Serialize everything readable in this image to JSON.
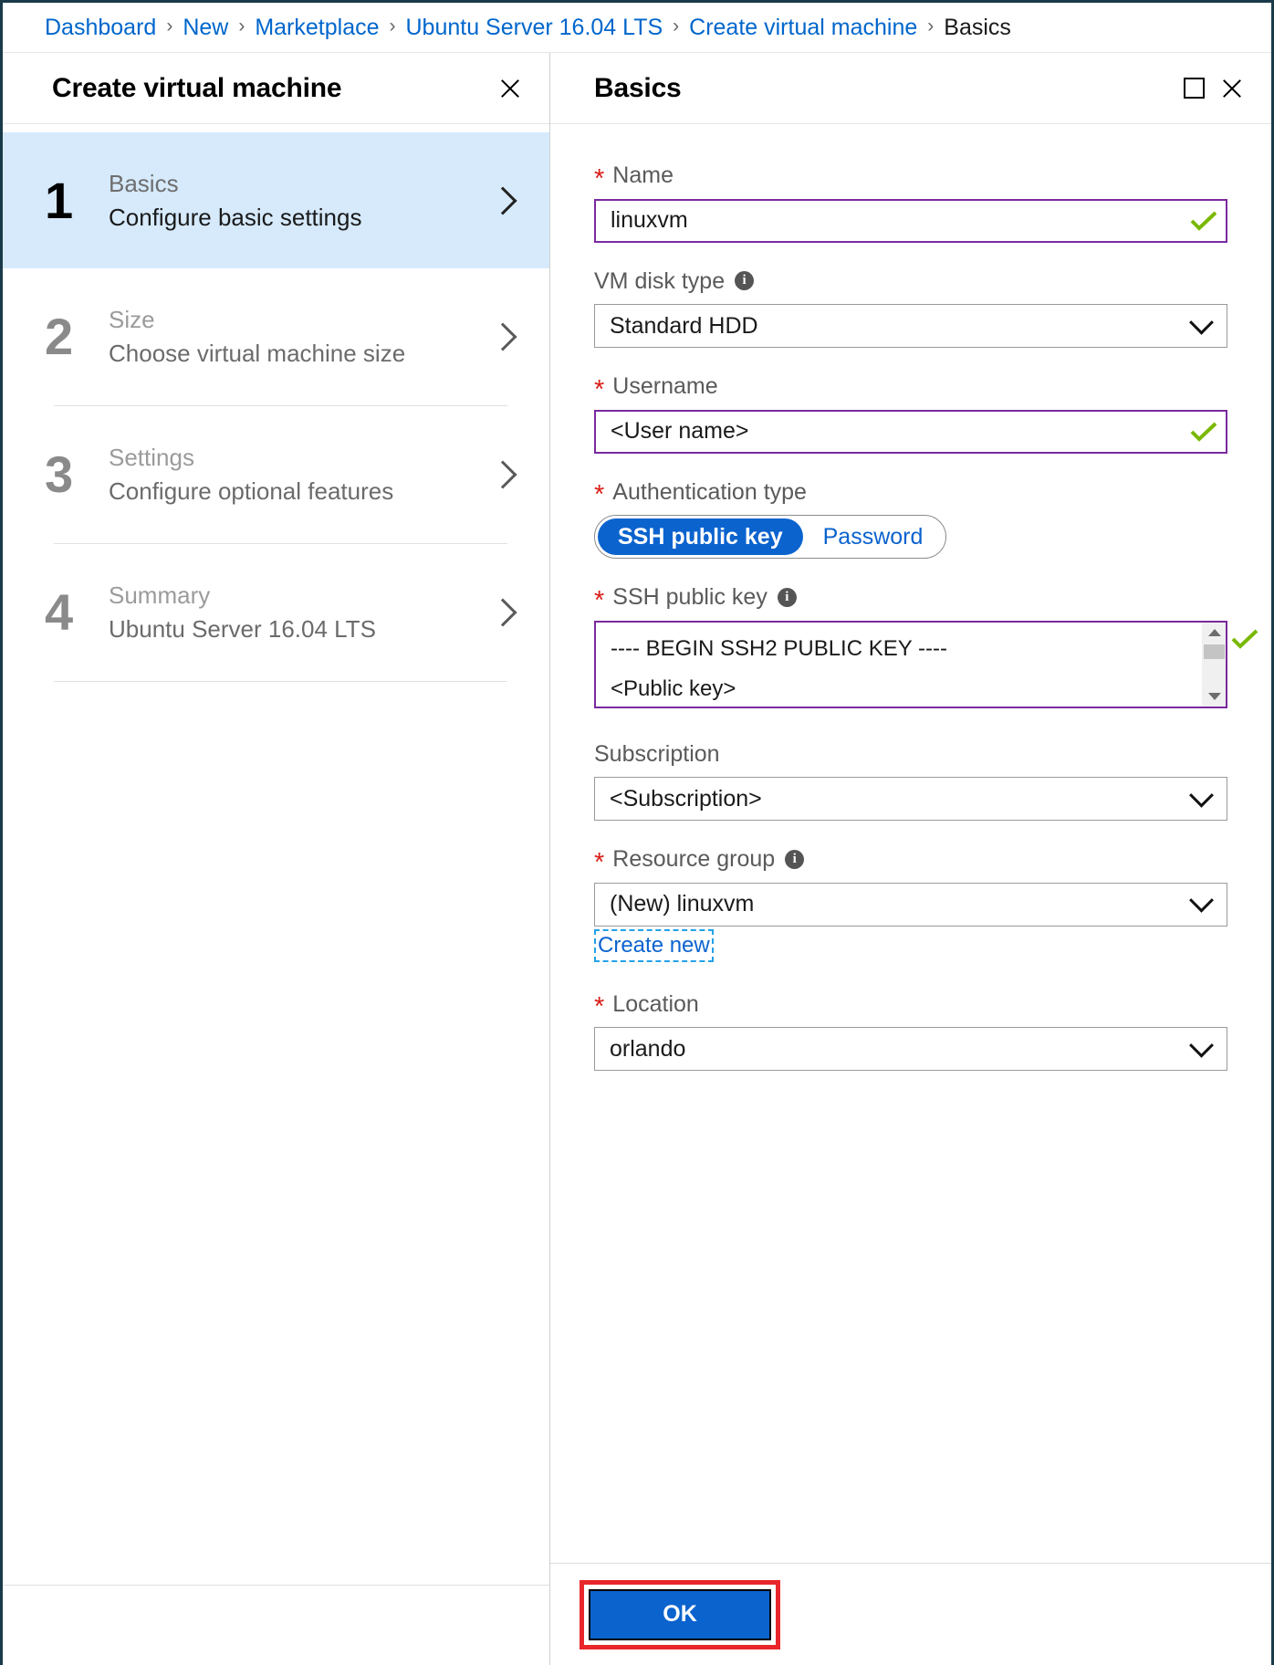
{
  "breadcrumb": {
    "items": [
      {
        "label": "Dashboard",
        "current": false
      },
      {
        "label": "New",
        "current": false
      },
      {
        "label": "Marketplace",
        "current": false
      },
      {
        "label": "Ubuntu Server 16.04 LTS",
        "current": false
      },
      {
        "label": "Create virtual machine",
        "current": false
      },
      {
        "label": "Basics",
        "current": true
      }
    ],
    "separator": "›"
  },
  "left_blade": {
    "title": "Create virtual machine",
    "close_icon": "close-icon",
    "steps": [
      {
        "num": "1",
        "name": "Basics",
        "desc": "Configure basic settings",
        "active": true
      },
      {
        "num": "2",
        "name": "Size",
        "desc": "Choose virtual machine size",
        "active": false
      },
      {
        "num": "3",
        "name": "Settings",
        "desc": "Configure optional features",
        "active": false
      },
      {
        "num": "4",
        "name": "Summary",
        "desc": "Ubuntu Server 16.04 LTS",
        "active": false
      }
    ]
  },
  "right_blade": {
    "title": "Basics",
    "maximize_icon": "maximize-icon",
    "close_icon": "close-icon",
    "fields": {
      "name": {
        "label": "Name",
        "value": "linuxvm",
        "required": true,
        "valid": true
      },
      "vm_disk_type": {
        "label": "VM disk type",
        "value": "Standard HDD",
        "required": false,
        "info": true
      },
      "username": {
        "label": "Username",
        "value": "<User name>",
        "required": true,
        "valid": true
      },
      "auth_type": {
        "label": "Authentication type",
        "required": true,
        "options": [
          "SSH public key",
          "Password"
        ],
        "selected": "SSH public key"
      },
      "ssh_public_key": {
        "label": "SSH public key",
        "required": true,
        "info": true,
        "line1": "---- BEGIN SSH2 PUBLIC KEY ----",
        "line2": "<Public key>",
        "valid": true
      },
      "subscription": {
        "label": "Subscription",
        "value": "<Subscription>",
        "required": false
      },
      "resource_group": {
        "label": "Resource group",
        "value": "(New) linuxvm",
        "required": true,
        "info": true,
        "create_new_label": "Create new"
      },
      "location": {
        "label": "Location",
        "value": "orlando",
        "required": true
      }
    },
    "footer": {
      "ok_label": "OK"
    }
  },
  "colors": {
    "accent_blue": "#0b63ce",
    "link_blue": "#0066cc",
    "valid_purple": "#7a2a9e",
    "check_green": "#7ab800",
    "required_red": "#d91e18",
    "highlight_red": "#e8262b",
    "active_step_bg": "#d6eafc"
  }
}
